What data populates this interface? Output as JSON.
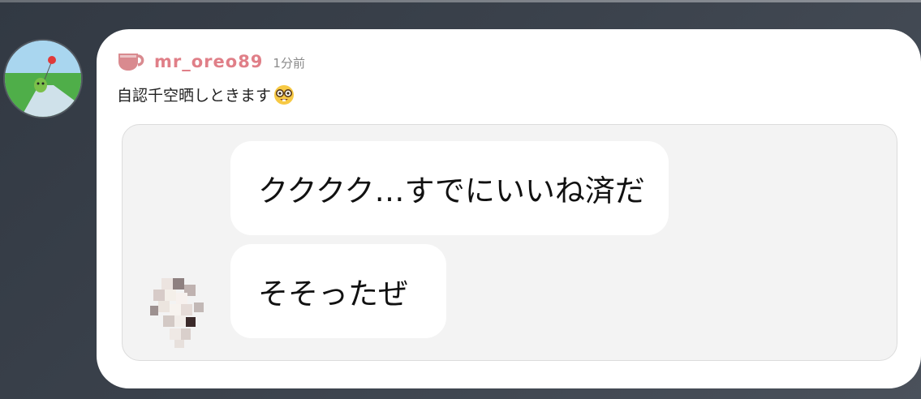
{
  "post": {
    "username": "mr_oreo89",
    "timestamp": "1分前",
    "text": "自認千空晒しときます",
    "emoji_icon": "nerd-face-icon"
  },
  "embedded_chat": {
    "messages": [
      {
        "text": "クククク…すでにいいね済だ"
      },
      {
        "text": "そそったぜ"
      }
    ]
  },
  "colors": {
    "username": "#e07f88",
    "cup_icon": "#d98a8f",
    "card_bg": "#ffffff",
    "embed_bg": "#f3f3f3",
    "page_bg": "#3b424c"
  }
}
